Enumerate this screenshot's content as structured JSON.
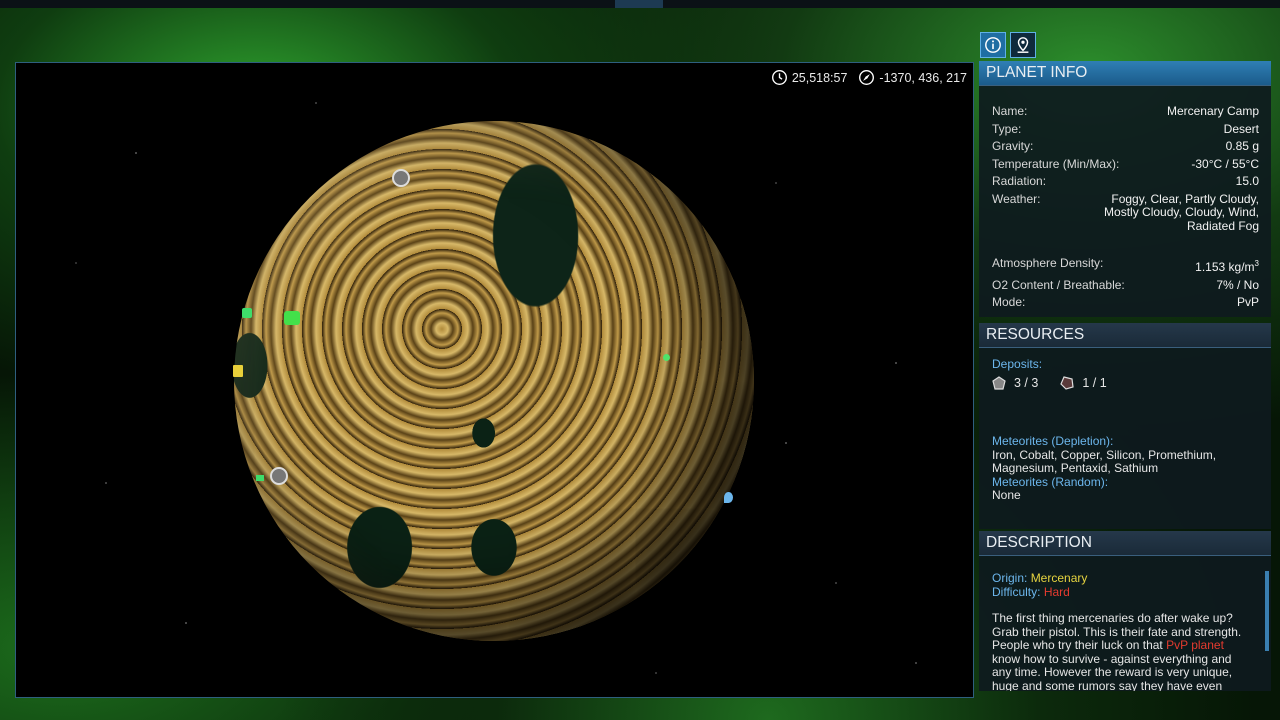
{
  "hud": {
    "time": "25,518:57",
    "coords": "-1370, 436, 217",
    "clock_icon": "clock-icon",
    "compass_icon": "compass-icon"
  },
  "tabs": [
    {
      "name": "info-tab",
      "icon": "info-icon",
      "active": true
    },
    {
      "name": "map-pin-tab",
      "icon": "map-pin-icon",
      "active": false
    }
  ],
  "planet_info": {
    "header": "PLANET INFO",
    "rows": [
      {
        "label": "Name:",
        "value": "Mercenary Camp"
      },
      {
        "label": "Type:",
        "value": "Desert"
      },
      {
        "label": "Gravity:",
        "value": "0.85 g"
      },
      {
        "label": "Temperature (Min/Max):",
        "value": "-30°C / 55°C"
      },
      {
        "label": "Radiation:",
        "value": "15.0"
      }
    ],
    "weather_label": "Weather:",
    "weather_lines": [
      "Foggy, Clear, Partly Cloudy,",
      "Mostly Cloudy, Cloudy, Wind,",
      "Radiated Fog"
    ],
    "atmosphere_label": "Atmosphere Density:",
    "atmosphere_value": "1.153 kg/m",
    "atmosphere_unit_sup": "3",
    "o2_label": "O2 Content / Breathable:",
    "o2_value": "7% / No",
    "mode_label": "Mode:",
    "mode_value": "PvP"
  },
  "resources": {
    "header": "RESOURCES",
    "deposits_label": "Deposits:",
    "deposits": [
      {
        "icon": "ore-rock-icon",
        "value": "3 / 3"
      },
      {
        "icon": "crystal-ore-icon",
        "value": "1 / 1"
      }
    ],
    "meteorites_depletion_label": "Meteorites (Depletion):",
    "meteorites_depletion_lines": [
      "Iron, Cobalt, Copper, Silicon, Promethium,",
      "Magnesium, Pentaxid, Sathium"
    ],
    "meteorites_random_label": "Meteorites (Random):",
    "meteorites_random_value": "None"
  },
  "description": {
    "header": "DESCRIPTION",
    "origin_label": "Origin:",
    "origin_value": "Mercenary",
    "difficulty_label": "Difficulty:",
    "difficulty_value": "Hard",
    "text_1": "The first thing mercenaries do after wake up? Grab their pistol. This is their fate and strength. People who try their luck on that ",
    "text_highlight": "PvP planet",
    "text_2": " know how to survive - against everything and any time. However the reward is very unique, huge and some rumors say they have even"
  },
  "colors": {
    "accent": "#2f7fb5",
    "pvp_red": "#e43b2f",
    "origin_yellow": "#e6d440",
    "label_blue": "#6cb6ec"
  }
}
